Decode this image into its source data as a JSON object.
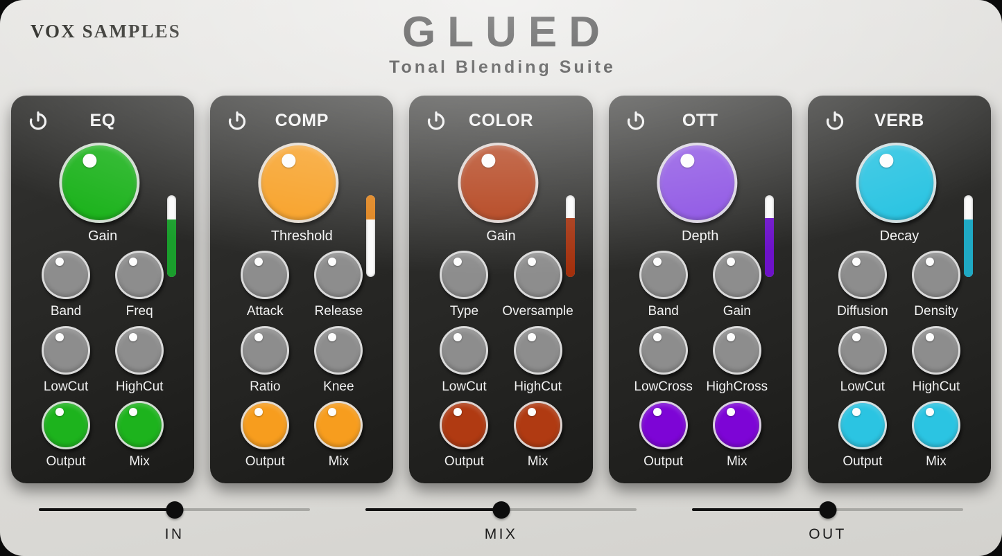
{
  "header": {
    "brand": "VOX SAMPLES",
    "title": "GLUED",
    "subtitle": "Tonal Blending Suite"
  },
  "colors": {
    "background": "#dedddA",
    "panel": "#2b2b29",
    "eq": "#1DB31D",
    "comp": "#F79D1E",
    "color": "#B03A12",
    "ott": "#8A4FE3",
    "ott_small": "#7D05D6",
    "verb": "#2BC4E2",
    "knob_gray": "#8d8d8d",
    "slider_fill": "#111111",
    "slider_track": "#a8a8a4"
  },
  "modules": [
    {
      "id": "eq",
      "title": "EQ",
      "power_icon": "power-icon",
      "enabled": true,
      "accent": "#1DB31D",
      "main_knob": {
        "label": "Gain",
        "color": "#1DB31D"
      },
      "meter": {
        "fill_color": "#1a9e2c",
        "fill_percent": 70,
        "fill_from": "bottom"
      },
      "knobs": [
        {
          "label": "Band",
          "color": "#8d8d8d"
        },
        {
          "label": "Freq",
          "color": "#8d8d8d"
        },
        {
          "label": "LowCut",
          "color": "#8d8d8d"
        },
        {
          "label": "HighCut",
          "color": "#8d8d8d"
        },
        {
          "label": "Output",
          "color": "#1DB31D"
        },
        {
          "label": "Mix",
          "color": "#1DB31D"
        }
      ]
    },
    {
      "id": "comp",
      "title": "COMP",
      "power_icon": "power-icon",
      "enabled": true,
      "accent": "#F79D1E",
      "main_knob": {
        "label": "Threshold",
        "color": "#F79D1E"
      },
      "meter": {
        "fill_color": "#DE7E12",
        "fill_percent": 30,
        "fill_from": "top"
      },
      "knobs": [
        {
          "label": "Attack",
          "color": "#8d8d8d"
        },
        {
          "label": "Release",
          "color": "#8d8d8d"
        },
        {
          "label": "Ratio",
          "color": "#8d8d8d"
        },
        {
          "label": "Knee",
          "color": "#8d8d8d"
        },
        {
          "label": "Output",
          "color": "#F79D1E"
        },
        {
          "label": "Mix",
          "color": "#F79D1E"
        }
      ]
    },
    {
      "id": "color",
      "title": "COLOR",
      "power_icon": "power-icon",
      "enabled": true,
      "accent": "#B03A12",
      "main_knob": {
        "label": "Gain",
        "color": "#B03A12"
      },
      "meter": {
        "fill_color": "#A32F0B",
        "fill_percent": 72,
        "fill_from": "bottom"
      },
      "knobs": [
        {
          "label": "Type",
          "color": "#8d8d8d"
        },
        {
          "label": "Oversample",
          "color": "#8d8d8d"
        },
        {
          "label": "LowCut",
          "color": "#8d8d8d"
        },
        {
          "label": "HighCut",
          "color": "#8d8d8d"
        },
        {
          "label": "Output",
          "color": "#B03A12"
        },
        {
          "label": "Mix",
          "color": "#B03A12"
        }
      ]
    },
    {
      "id": "ott",
      "title": "OTT",
      "power_icon": "power-icon",
      "enabled": true,
      "accent": "#8A4FE3",
      "main_knob": {
        "label": "Depth",
        "color": "#8A4FE3"
      },
      "meter": {
        "fill_color": "#6D12C9",
        "fill_percent": 72,
        "fill_from": "bottom"
      },
      "knobs": [
        {
          "label": "Band",
          "color": "#8d8d8d"
        },
        {
          "label": "Gain",
          "color": "#8d8d8d"
        },
        {
          "label": "LowCross",
          "color": "#8d8d8d"
        },
        {
          "label": "HighCross",
          "color": "#8d8d8d"
        },
        {
          "label": "Output",
          "color": "#7D05D6"
        },
        {
          "label": "Mix",
          "color": "#7D05D6"
        }
      ]
    },
    {
      "id": "verb",
      "title": "VERB",
      "power_icon": "power-icon",
      "enabled": true,
      "accent": "#2BC4E2",
      "main_knob": {
        "label": "Decay",
        "color": "#2BC4E2"
      },
      "meter": {
        "fill_color": "#1FA9C4",
        "fill_percent": 70,
        "fill_from": "bottom"
      },
      "knobs": [
        {
          "label": "Diffusion",
          "color": "#8d8d8d"
        },
        {
          "label": "Density",
          "color": "#8d8d8d"
        },
        {
          "label": "LowCut",
          "color": "#8d8d8d"
        },
        {
          "label": "HighCut",
          "color": "#8d8d8d"
        },
        {
          "label": "Output",
          "color": "#2BC4E2"
        },
        {
          "label": "Mix",
          "color": "#2BC4E2"
        }
      ]
    }
  ],
  "sliders": [
    {
      "id": "in",
      "label": "IN",
      "value_percent": 50
    },
    {
      "id": "mix",
      "label": "MIX",
      "value_percent": 50
    },
    {
      "id": "out",
      "label": "OUT",
      "value_percent": 50
    }
  ]
}
